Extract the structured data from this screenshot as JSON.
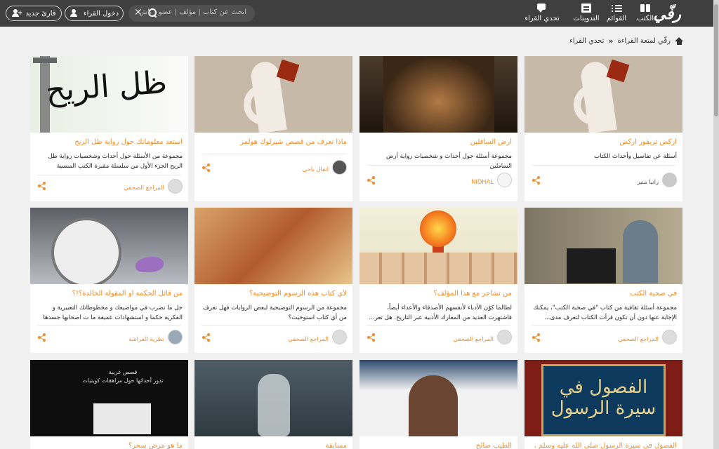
{
  "header": {
    "logo": "رفّي",
    "nav": [
      {
        "label": "الكتب",
        "icon": "book-icon"
      },
      {
        "label": "القوائم",
        "icon": "list-icon"
      },
      {
        "label": "التدوينات",
        "icon": "post-icon"
      },
      {
        "label": "تحدي القراء",
        "icon": "chat-icon"
      }
    ],
    "search": {
      "placeholder": "ابحث عن كتاب | مؤلف | عضو | ناش"
    },
    "login_label": "دخول القراء",
    "register_label": "قارئ جديد"
  },
  "breadcrumb": {
    "home": "رفّي لمتعة القراءة",
    "current": "تحدي القراء"
  },
  "cards": [
    {
      "title": "اركض تريفور اركض",
      "desc": "أسئلة عن تفاصيل وأحداث الكتاب",
      "author": "رانيا منير"
    },
    {
      "title": "أرض السافلين",
      "desc": "مجموعة أسئلة حول أحداث و شخصيات رواية أرض السافلين",
      "author": "NIDHAL"
    },
    {
      "title": "ماذا تعرف من قصص شيرلوك هولمز",
      "desc": "",
      "author": "انفال باحي"
    },
    {
      "title": "استعد معلوماتك حول رواية ظل الريح",
      "desc": "مجموعة من الأسئلة حول أحداث وشخصيات رواية ظل الريح الجزء الأول من سلسلة مقبرة الكتب المنسية",
      "author": "المراجع الصحفي"
    },
    {
      "title": "في صحبة الكتب",
      "desc": "مجموعة أسئلة ثقافية من كتاب \"في صحبة الكتب\"، يمكنك الإجابة عنها دون أن تكون قرأت الكتاب لتعرف مدى...",
      "author": "المراجع الصحفي"
    },
    {
      "title": "من تشاجر مع هذا المؤلف؟",
      "desc": "لطالما كوّن الأدباء لأنفسهم الأصدقاء والأعداء أيضاً، فاشتهرت العديد من المعارك الأدبية عبر التاريخ. هل تعر...",
      "author": "المراجع الصحفي"
    },
    {
      "title": "لأي كتاب هذه الرسوم التوضيحية؟",
      "desc": "مجموعة من الرسوم التوضيحية لبعض الروايات فهل تعرف من أي كتاب استوحيت؟",
      "author": "المراجع الصحفي"
    },
    {
      "title": "من قائل الحكمة أو المقولة الخالدة؟!؟",
      "desc": "جل ما تضرب في مواضيعك و مخطوطاتك التعبيرية و الفكرية حكما و استشهادات عميقة ما ت اصحابها جسدها و...",
      "author": "نظرية الفراشة"
    },
    {
      "title": "الفصول في سيرة الرسول صلى الله عليه وسلم ،",
      "desc": "",
      "author": ""
    },
    {
      "title": "الطيب صالح",
      "desc": "",
      "author": ""
    },
    {
      "title": "مسابقة",
      "desc": "",
      "author": ""
    },
    {
      "title": "ما هو مرض سحر؟",
      "desc": "",
      "author": ""
    }
  ],
  "cover_text": {
    "arabic_calligraphy": "ظل الريح",
    "noir_line1": "قصص غريبة",
    "noir_line2": "تدور أحداثها حول مراهقات كويتيات",
    "manuscript": "الفصول في سيرة الرسول"
  },
  "colors": {
    "accent": "#f08c2c",
    "header_bg": "#3f3f3f",
    "page_bg": "#f0f0f0"
  }
}
